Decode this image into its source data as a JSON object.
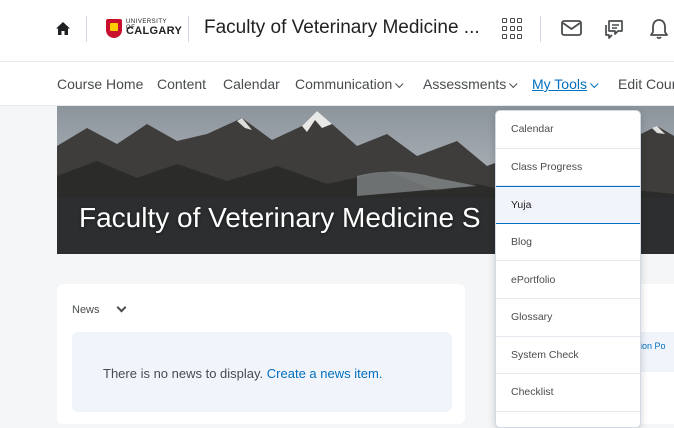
{
  "header": {
    "logo_small": "UNIVERSITY OF",
    "logo_text": "CALGARY",
    "course_title": "Faculty of Veterinary Medicine ..."
  },
  "nav": {
    "items": [
      {
        "label": "Course Home"
      },
      {
        "label": "Content"
      },
      {
        "label": "Calendar"
      },
      {
        "label": "Communication"
      },
      {
        "label": "Assessments"
      },
      {
        "label": "My Tools"
      },
      {
        "label": "Edit Cour"
      }
    ]
  },
  "banner": {
    "title": "Faculty of Veterinary Medicine S"
  },
  "news": {
    "heading": "News",
    "empty_text": "There is no news to display.",
    "create_link": "Create a news item."
  },
  "side_widget": {
    "partial_text": "ion Po"
  },
  "dropdown": {
    "items": [
      {
        "label": "Calendar"
      },
      {
        "label": "Class Progress"
      },
      {
        "label": "Yuja"
      },
      {
        "label": "Blog"
      },
      {
        "label": "ePortfolio"
      },
      {
        "label": "Glossary"
      },
      {
        "label": "System Check"
      },
      {
        "label": "Checklist"
      }
    ],
    "selected": "Yuja"
  },
  "colors": {
    "accent": "#006fbf",
    "text": "#494c4e",
    "page_bg": "#f5f6f8",
    "brand_red": "#c8102e",
    "brand_gold": "#ffcd00"
  },
  "icons": [
    "home-icon",
    "app-grid-icon",
    "mail-icon",
    "chat-icon",
    "bell-icon",
    "chevron-down-icon"
  ]
}
